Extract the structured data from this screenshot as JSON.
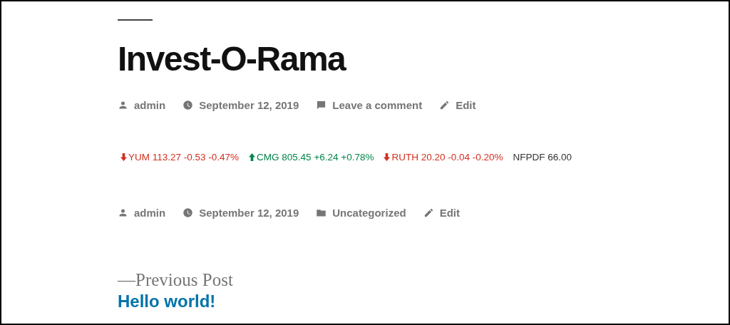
{
  "post": {
    "title": "Invest-O-Rama",
    "header_meta": [
      {
        "kind": "author",
        "text": "admin"
      },
      {
        "kind": "date",
        "text": "September 12, 2019"
      },
      {
        "kind": "comments",
        "text": "Leave a comment"
      },
      {
        "kind": "edit",
        "text": "Edit"
      }
    ],
    "ticker": [
      {
        "kind": "down",
        "text": "YUM 113.27 -0.53 -0.47%"
      },
      {
        "kind": "up",
        "text": "CMG 805.45 +6.24 +0.78%"
      },
      {
        "kind": "down",
        "text": "RUTH 20.20 -0.04 -0.20%"
      },
      {
        "kind": "flat",
        "text": "NFPDF 66.00"
      }
    ],
    "footer_meta": [
      {
        "kind": "author",
        "text": "admin"
      },
      {
        "kind": "date",
        "text": "September 12, 2019"
      },
      {
        "kind": "category",
        "text": "Uncategorized"
      },
      {
        "kind": "edit",
        "text": "Edit"
      }
    ]
  },
  "navigation": {
    "label": "—Previous Post",
    "link": "Hello world!"
  }
}
